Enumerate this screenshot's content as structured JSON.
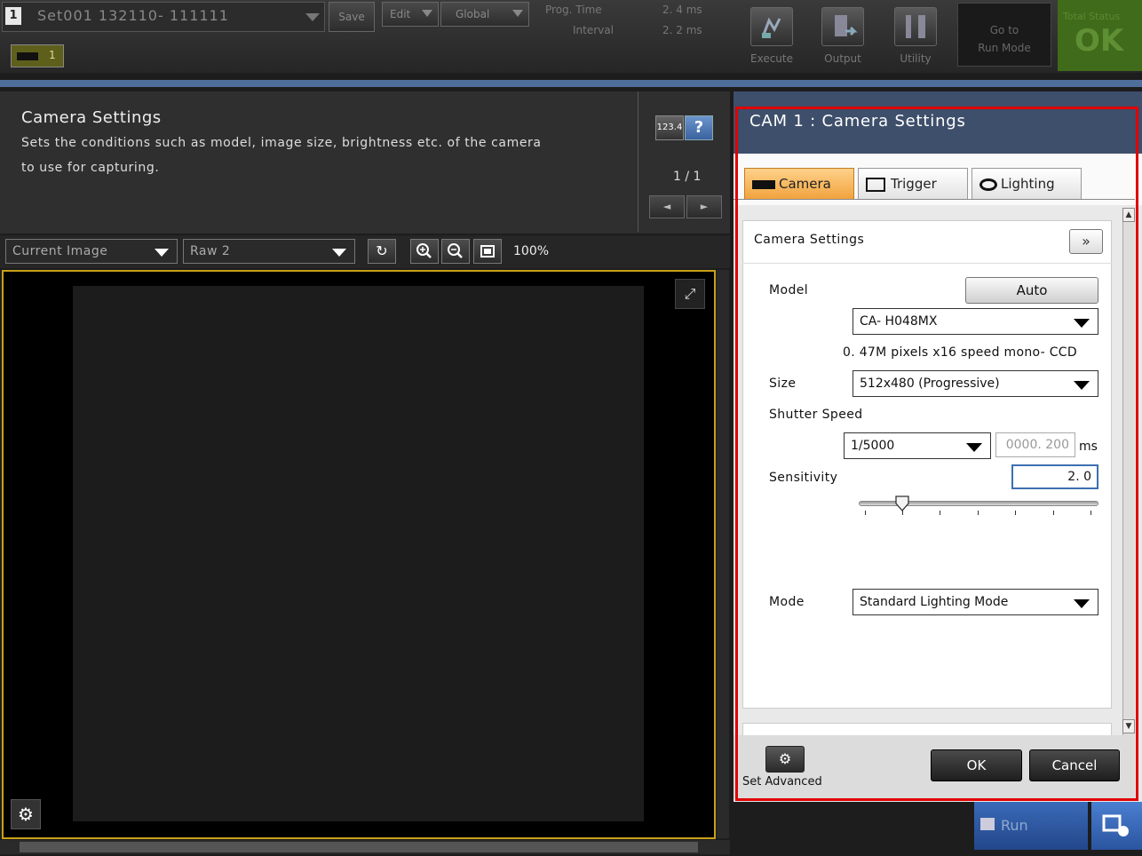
{
  "topbar": {
    "set_number": "1",
    "set_name": "Set001  132110- 111111",
    "save_label": "Save",
    "edit_label": "Edit",
    "global_label": "Global",
    "prog_time_label": "Prog.  Time",
    "interval_label": "Interval",
    "prog_time_value": "2. 4  ms",
    "interval_value": "2. 2  ms",
    "execute_label": "Execute",
    "output_label": "Output",
    "utility_label": "Utility",
    "run_mode_line1": "Go  to",
    "run_mode_line2": "Run  Mode",
    "status_label": "Total  Status",
    "status_value": "OK",
    "camera_tab_label": "1"
  },
  "left": {
    "title": "Camera  Settings",
    "desc_line1": "Sets  the  conditions  such  as  model,  image  size,  brightness  etc.  of  the  camera",
    "desc_line2": "to  use  for  capturing.",
    "numeric_badge": "123.4",
    "help_label": "?",
    "page": "1 / 1",
    "prev_label": "◄",
    "next_label": "►",
    "image_source": "Current  Image",
    "image_type": "Raw  2",
    "zoom": "100%"
  },
  "panel": {
    "title": "CAM  1  :  Camera  Settings",
    "tabs": [
      {
        "label": "Camera"
      },
      {
        "label": "Trigger"
      },
      {
        "label": "Lighting"
      }
    ],
    "section_title": "Camera  Settings",
    "expand_label": "»",
    "model_label": "Model",
    "auto_label": "Auto",
    "model_value": "CA- H048MX",
    "model_desc": "0. 47M  pixels  x16  speed  mono- CCD",
    "size_label": "Size",
    "size_value": "512x480  (Progressive)",
    "shutter_label": "Shutter  Speed",
    "shutter_value": "1/5000",
    "shutter_ms_placeholder": "0000. 200",
    "shutter_unit": "ms",
    "sensitivity_label": "Sensitivity",
    "sensitivity_value": "2. 0",
    "sensitivity_slider_fraction": 0.18,
    "mode_label": "Mode",
    "mode_value": "Standard  Lighting  Mode",
    "set_advanced_label": "Set  Advanced",
    "ok_label": "OK",
    "cancel_label": "Cancel"
  },
  "bottom": {
    "run_label": "Run"
  },
  "colors": {
    "accent_blue": "#3e4f6b",
    "tab_active": "#f0a23c",
    "frame_highlight": "#e00000",
    "image_border": "#c9a018"
  }
}
